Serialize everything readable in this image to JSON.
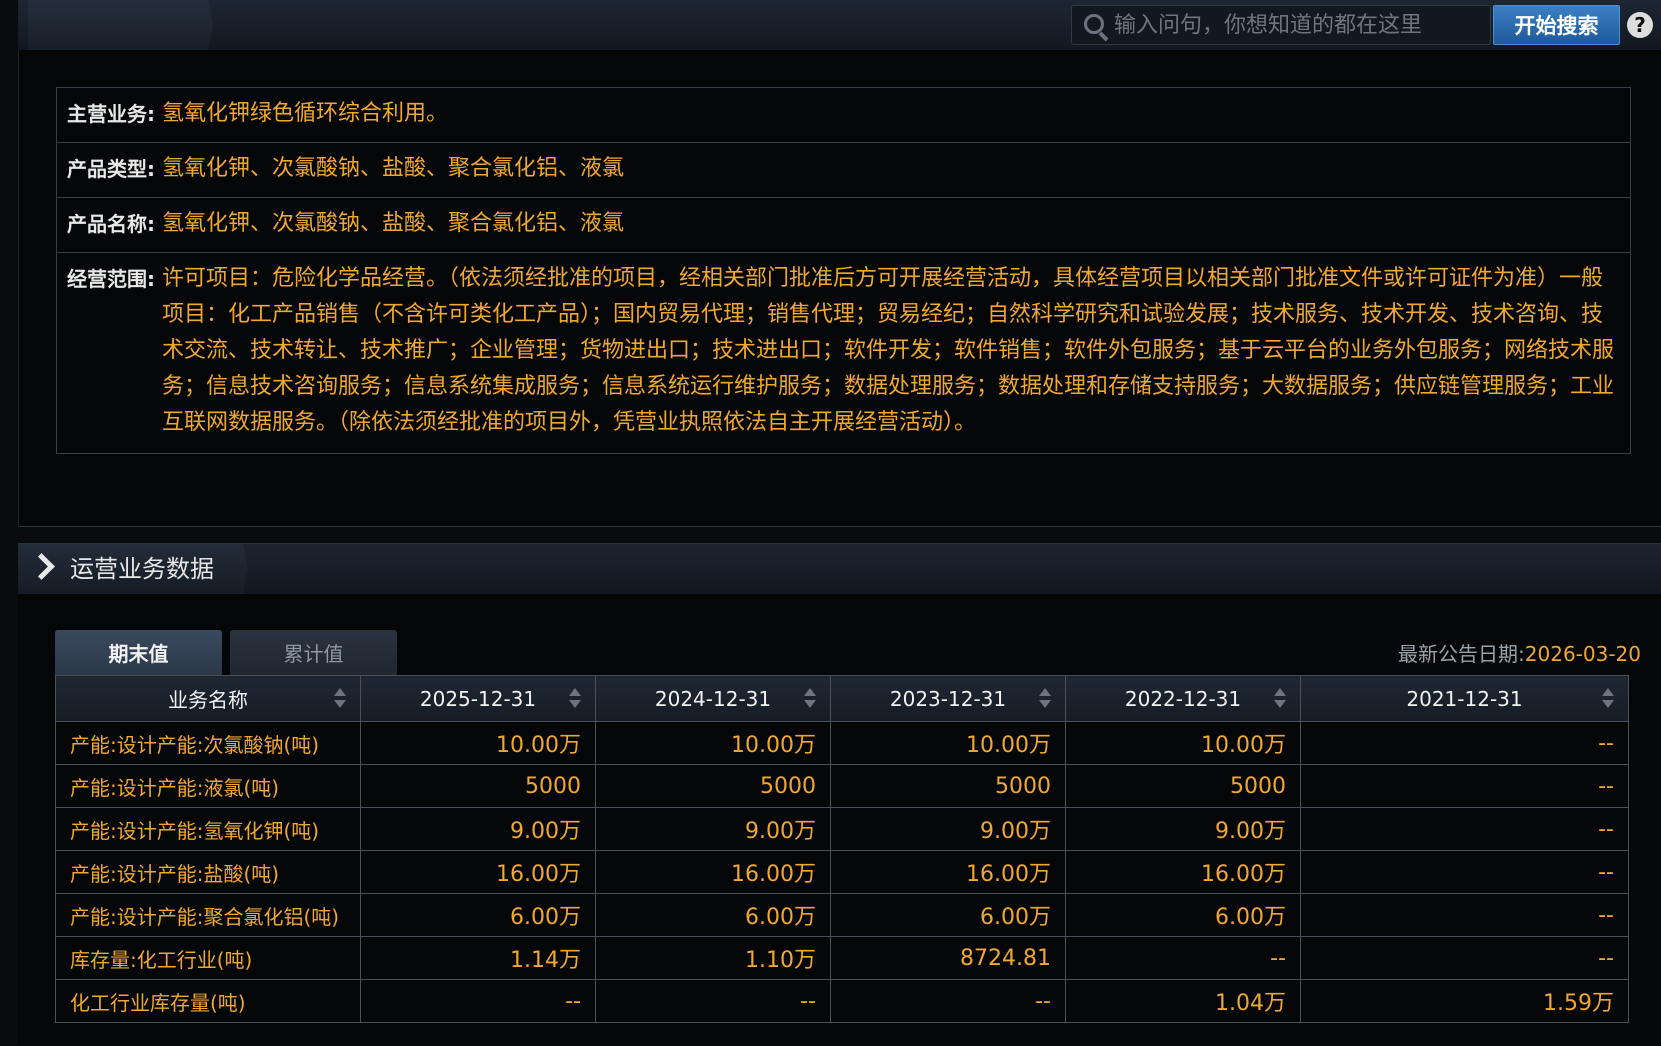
{
  "search": {
    "placeholder": "输入问句，你想知道的都在这里",
    "button_label": "开始搜索",
    "help_label": "?"
  },
  "info": {
    "rows": [
      {
        "label": "主营业务:",
        "value": "氢氧化钾绿色循环综合利用。"
      },
      {
        "label": "产品类型:",
        "value": "氢氧化钾、次氯酸钠、盐酸、聚合氯化铝、液氯"
      },
      {
        "label": "产品名称:",
        "value": "氢氧化钾、次氯酸钠、盐酸、聚合氯化铝、液氯"
      },
      {
        "label": "经营范围:",
        "value": "许可项目：危险化学品经营。（依法须经批准的项目，经相关部门批准后方可开展经营活动，具体经营项目以相关部门批准文件或许可证件为准）一般项目：化工产品销售（不含许可类化工产品）；国内贸易代理；销售代理；贸易经纪；自然科学研究和试验发展；技术服务、技术开发、技术咨询、技术交流、技术转让、技术推广；企业管理；货物进出口；技术进出口；软件开发；软件销售；软件外包服务；基于云平台的业务外包服务；网络技术服务；信息技术咨询服务；信息系统集成服务；信息系统运行维护服务；数据处理服务；数据处理和存储支持服务；大数据服务；供应链管理服务；工业互联网数据服务。（除依法须经批准的项目外，凭营业执照依法自主开展经营活动）。"
      }
    ]
  },
  "section": {
    "title": "运营业务数据"
  },
  "tabs": {
    "active": "期末值",
    "inactive": "累计值"
  },
  "announce": {
    "label": "最新公告日期:",
    "value": "2026-03-20"
  },
  "table": {
    "headers": [
      "业务名称",
      "2025-12-31",
      "2024-12-31",
      "2023-12-31",
      "2022-12-31",
      "2021-12-31"
    ],
    "rows": [
      [
        "产能:设计产能:次氯酸钠(吨)",
        "10.00万",
        "10.00万",
        "10.00万",
        "10.00万",
        "--"
      ],
      [
        "产能:设计产能:液氯(吨)",
        "5000",
        "5000",
        "5000",
        "5000",
        "--"
      ],
      [
        "产能:设计产能:氢氧化钾(吨)",
        "9.00万",
        "9.00万",
        "9.00万",
        "9.00万",
        "--"
      ],
      [
        "产能:设计产能:盐酸(吨)",
        "16.00万",
        "16.00万",
        "16.00万",
        "16.00万",
        "--"
      ],
      [
        "产能:设计产能:聚合氯化铝(吨)",
        "6.00万",
        "6.00万",
        "6.00万",
        "6.00万",
        "--"
      ],
      [
        "库存量:化工行业(吨)",
        "1.14万",
        "1.10万",
        "8724.81",
        "--",
        "--"
      ],
      [
        "化工行业库存量(吨)",
        "--",
        "--",
        "--",
        "1.04万",
        "1.59万"
      ]
    ]
  },
  "colors": {
    "accent": "#f0a830",
    "button": "#2a6cb0",
    "background": "#050607"
  }
}
